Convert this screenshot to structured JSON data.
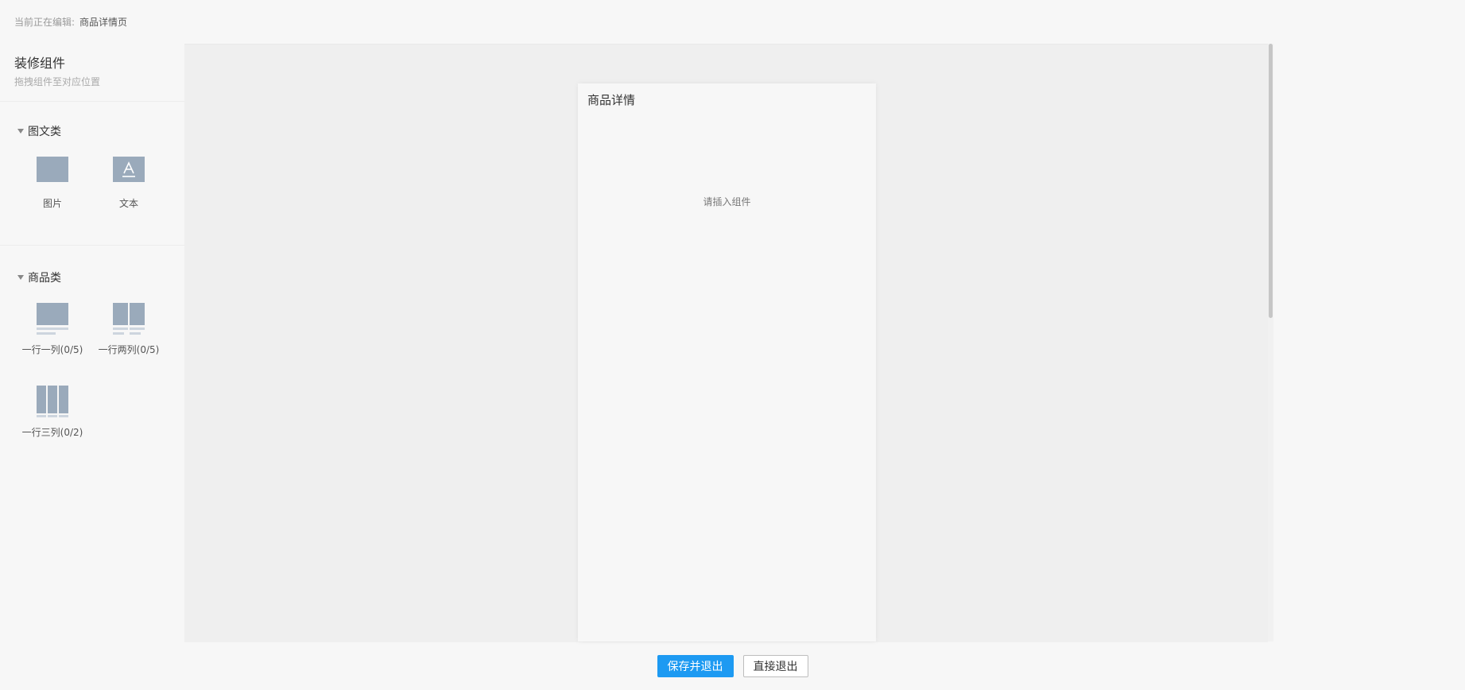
{
  "header": {
    "editing_label": "当前正在编辑:",
    "editing_page": "商品详情页"
  },
  "sidebar": {
    "title": "装修组件",
    "subtitle": "拖拽组件至对应位置",
    "groups": [
      {
        "label": "图文类",
        "items": [
          {
            "label": "图片",
            "icon": "image-icon"
          },
          {
            "label": "文本",
            "icon": "text-icon"
          }
        ]
      },
      {
        "label": "商品类",
        "items": [
          {
            "label": "一行一列(0/5)",
            "icon": "one-column-icon"
          },
          {
            "label": "一行两列(0/5)",
            "icon": "two-column-icon"
          },
          {
            "label": "一行三列(0/2)",
            "icon": "three-column-icon"
          }
        ]
      }
    ]
  },
  "preview": {
    "title": "商品详情",
    "placeholder": "请插入组件"
  },
  "footer": {
    "save_exit": "保存并退出",
    "exit": "直接退出"
  },
  "colors": {
    "primary": "#1d9af2",
    "icon": "#9aaabb",
    "icon_line": "#cdd5de"
  }
}
